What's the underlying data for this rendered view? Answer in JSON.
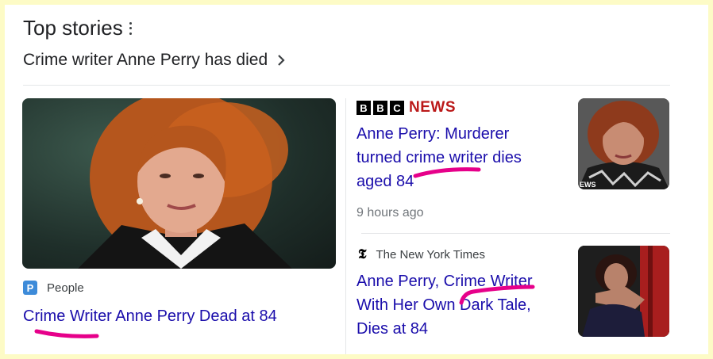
{
  "header": {
    "title": "Top stories",
    "subtitle": "Crime writer Anne Perry has died"
  },
  "stories": [
    {
      "source": "People",
      "source_logo_letter": "P",
      "headline": "Crime Writer Anne Perry Dead at 84"
    },
    {
      "source": "BBC NEWS",
      "source_logo_letters": [
        "B",
        "B",
        "C"
      ],
      "source_logo_word": "NEWS",
      "headline_lines": [
        "Anne Perry: Murderer",
        "turned crime writer dies",
        "aged 84"
      ],
      "time": "9 hours ago",
      "thumb_caption": "EWS"
    },
    {
      "source": "The New York Times",
      "source_logo_glyph": "𝕿",
      "headline_lines": [
        "Anne Perry, Crime Writer",
        "With Her Own Dark Tale,",
        "Dies at 84"
      ]
    }
  ],
  "colors": {
    "link": "#1a0dab",
    "highlight_marker": "#e6008a",
    "page_background": "#fdfbc6",
    "bbc_red": "#bb1919",
    "people_blue": "#3d8bd9"
  },
  "icons": {
    "more_options": "three-vertical-dots-icon",
    "subtitle_arrow": "chevron-right-icon"
  }
}
